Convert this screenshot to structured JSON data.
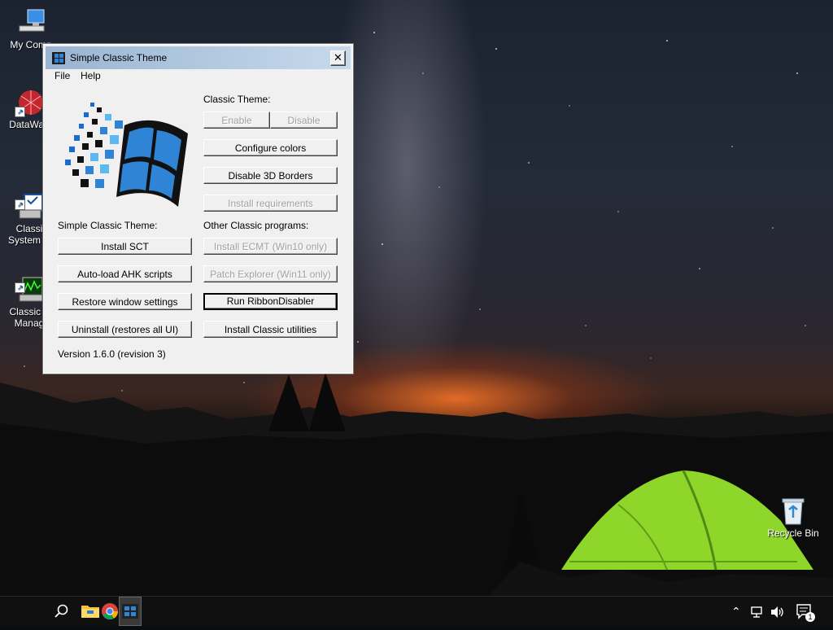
{
  "desktop": {
    "icons": [
      {
        "label": "My Comp",
        "icon": "computer-icon"
      },
      {
        "label": "DataWag",
        "icon": "datawag-icon"
      },
      {
        "label": "Classi\nSystem C",
        "icon": "classic-system-config-icon"
      },
      {
        "label": "Classic T\nManag",
        "icon": "classic-task-manager-icon"
      },
      {
        "label": "Recycle Bin",
        "icon": "recycle-bin-icon"
      }
    ]
  },
  "window": {
    "title": "Simple Classic Theme",
    "close_label": "✕",
    "menu": [
      "File",
      "Help"
    ],
    "classic_theme_label": "Classic Theme:",
    "enable_label": "Enable",
    "disable_label": "Disable",
    "configure_colors_label": "Configure colors",
    "disable_3d_borders_label": "Disable 3D Borders",
    "install_requirements_label": "Install requirements",
    "sct_section_label": "Simple Classic Theme:",
    "other_programs_label": "Other Classic programs:",
    "install_sct_label": "Install SCT",
    "install_ecmt_label": "Install ECMT (Win10 only)",
    "autoload_ahk_label": "Auto-load AHK scripts",
    "patch_explorer_label": "Patch Explorer (Win11 only)",
    "restore_window_label": "Restore window settings",
    "run_ribbon_label": "Run RibbonDisabler",
    "uninstall_label": "Uninstall (restores all UI)",
    "install_classic_utils_label": "Install Classic utilities",
    "version": "Version 1.6.0 (revision 3)"
  },
  "taskbar": {
    "search_icon": "search-icon",
    "apps": [
      "file-explorer-icon",
      "chrome-icon",
      "simple-classic-theme-icon"
    ],
    "tray": [
      "chevron-up-icon",
      "network-icon",
      "volume-icon",
      "notification-icon"
    ],
    "notification_count": "1"
  },
  "colors": {
    "titlebar_start": "#99b4d1",
    "titlebar_end": "#c7daec",
    "window_face": "#f0f0f0",
    "tent": "#8fd62a"
  }
}
